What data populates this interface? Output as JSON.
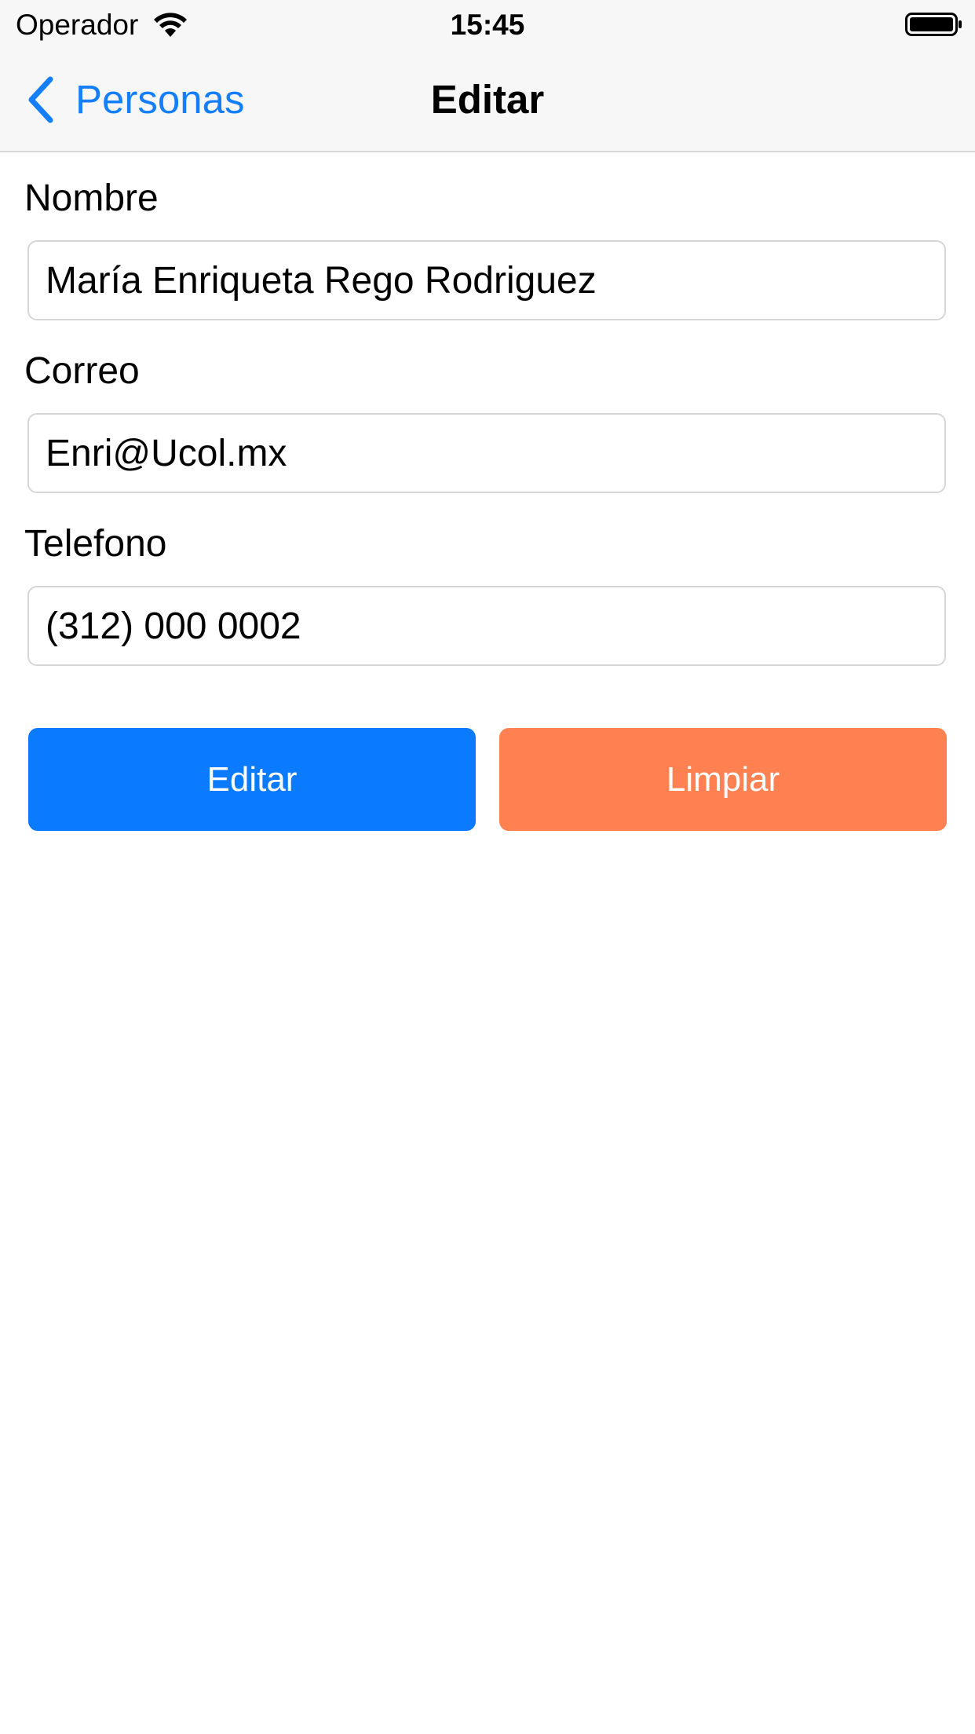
{
  "status_bar": {
    "carrier": "Operador",
    "time": "15:45",
    "wifi_icon": "wifi-icon",
    "battery_icon": "battery-icon"
  },
  "nav_bar": {
    "back_label": "Personas",
    "back_icon": "chevron-left-icon",
    "title": "Editar"
  },
  "form": {
    "nombre": {
      "label": "Nombre",
      "value": "María Enriqueta Rego Rodriguez"
    },
    "correo": {
      "label": "Correo",
      "value": "Enri@Ucol.mx"
    },
    "telefono": {
      "label": "Telefono",
      "value": "(312) 000 0002"
    }
  },
  "actions": {
    "edit_label": "Editar",
    "clear_label": "Limpiar"
  },
  "colors": {
    "accent_blue": "#0a7aff",
    "link_blue": "#147efb",
    "clear_orange": "#ff8051",
    "bar_background": "#f7f7f7"
  }
}
